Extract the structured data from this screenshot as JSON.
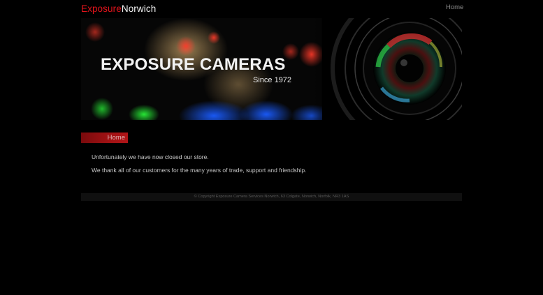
{
  "header": {
    "logo_part1": "Exposure",
    "logo_part2": "Norwich",
    "nav_home": "Home"
  },
  "banner": {
    "title": "EXPOSURE CAMERAS",
    "subtitle": "Since 1972"
  },
  "sidebar": {
    "items": [
      {
        "label": "Home"
      }
    ]
  },
  "main": {
    "paragraphs": [
      "Unfortunately we have now closed our store.",
      "We thank all of our customers for the many years of trade, support and friendship."
    ]
  },
  "footer": {
    "copyright": "© Copyright Exposure Camera Services Norwich, 63 Colgate, Norwich, Norfolk, NR3 1AS"
  },
  "colors": {
    "background": "#000000",
    "brand_red": "#e3141b",
    "nav_active_red": "#a11214",
    "text": "#c9c9c9"
  }
}
